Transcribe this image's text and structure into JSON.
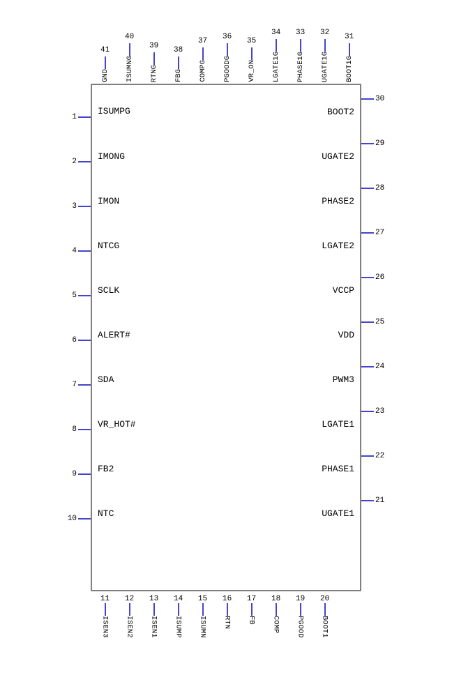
{
  "chip": {
    "top_pins": [
      {
        "num": "41",
        "label": "GND"
      },
      {
        "num": "40",
        "label": "ISUMNG"
      },
      {
        "num": "39",
        "label": "RTNG"
      },
      {
        "num": "38",
        "label": "FBG"
      },
      {
        "num": "37",
        "label": "COMPG"
      },
      {
        "num": "36",
        "label": "PGOODG"
      },
      {
        "num": "35",
        "label": "VR_ON"
      },
      {
        "num": "34",
        "label": "LGATE1G"
      },
      {
        "num": "33",
        "label": "PHASE1G"
      },
      {
        "num": "32",
        "label": "UGATE1G"
      },
      {
        "num": "31",
        "label": "BOOT1G"
      }
    ],
    "bottom_pins": [
      {
        "num": "11",
        "label": "ISEN3"
      },
      {
        "num": "12",
        "label": "ISEN2"
      },
      {
        "num": "13",
        "label": "ISEN1"
      },
      {
        "num": "14",
        "label": "ISUMP"
      },
      {
        "num": "15",
        "label": "ISUMN"
      },
      {
        "num": "16",
        "label": "RTN"
      },
      {
        "num": "17",
        "label": "FB"
      },
      {
        "num": "18",
        "label": "COMP"
      },
      {
        "num": "19",
        "label": "PGOOD"
      },
      {
        "num": "20",
        "label": "BOOT1"
      }
    ],
    "left_pins": [
      {
        "num": "1",
        "label": "ISUMPG"
      },
      {
        "num": "2",
        "label": "IMONG"
      },
      {
        "num": "3",
        "label": "IMON"
      },
      {
        "num": "4",
        "label": "NTCG"
      },
      {
        "num": "5",
        "label": "SCLK"
      },
      {
        "num": "6",
        "label": "ALERT#"
      },
      {
        "num": "7",
        "label": "SDA"
      },
      {
        "num": "8",
        "label": "VR_HOT#"
      },
      {
        "num": "9",
        "label": "FB2"
      },
      {
        "num": "10",
        "label": "NTC"
      }
    ],
    "right_pins": [
      {
        "num": "30",
        "label": "BOOT2"
      },
      {
        "num": "29",
        "label": "UGATE2"
      },
      {
        "num": "28",
        "label": "PHASE2"
      },
      {
        "num": "27",
        "label": "LGATE2"
      },
      {
        "num": "26",
        "label": "VCCP"
      },
      {
        "num": "25",
        "label": "VDD"
      },
      {
        "num": "24",
        "label": "PWM3"
      },
      {
        "num": "23",
        "label": "LGATE1"
      },
      {
        "num": "22",
        "label": "PHASE1"
      },
      {
        "num": "21",
        "label": "UGATE1"
      }
    ]
  }
}
